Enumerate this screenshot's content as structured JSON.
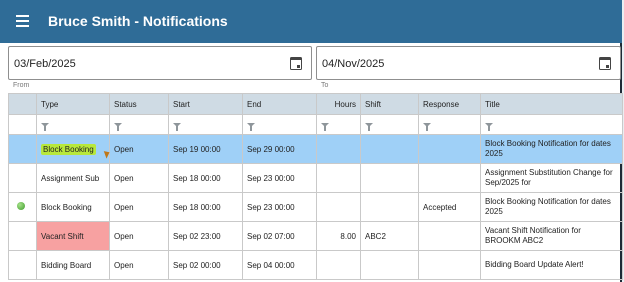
{
  "app": {
    "title": "Bruce Smith - Notifications"
  },
  "filters": {
    "from": {
      "value": "03/Feb/2025",
      "label": "From"
    },
    "to": {
      "value": "04/Nov/2025",
      "label": "To"
    }
  },
  "table": {
    "columns": [
      "Type",
      "Status",
      "Start",
      "End",
      "Hours",
      "Shift",
      "Response",
      "Title"
    ],
    "rows": [
      {
        "indicator": "",
        "type": "Block Booking",
        "status": "Open",
        "start": "Sep 19 00:00",
        "end": "Sep 29 00:00",
        "hours": "",
        "shift": "",
        "response": "",
        "title": "Block Booking Notification for dates 2025",
        "selected": true
      },
      {
        "indicator": "",
        "type": "Assignment Sub",
        "status": "Open",
        "start": "Sep 18 00:00",
        "end": "Sep 23 00:00",
        "hours": "",
        "shift": "",
        "response": "",
        "title": "Assignment Substitution Change for Sep/2025 for"
      },
      {
        "indicator": "green-status-dot-icon",
        "type": "Block Booking",
        "status": "Open",
        "start": "Sep 18 00:00",
        "end": "Sep 23 00:00",
        "hours": "",
        "shift": "",
        "response": "Accepted",
        "title": "Block Booking Notification for dates 2025"
      },
      {
        "indicator": "",
        "type": "Vacant Shift",
        "status": "Open",
        "start": "Sep 02 23:00",
        "end": "Sep 02 07:00",
        "hours": "8.00",
        "shift": "ABC2",
        "response": "",
        "title": "Vacant Shift Notification for BROOKM ABC2",
        "type_highlight": "#f7a1a1"
      },
      {
        "indicator": "",
        "type": "Bidding Board",
        "status": "Open",
        "start": "Sep 02 00:00",
        "end": "Sep 04 00:00",
        "hours": "",
        "shift": "",
        "response": "",
        "title": "Bidding Board Update Alert!"
      }
    ]
  },
  "colors": {
    "appbar": "#2f6c97",
    "header_row": "#cfdbe4",
    "selected_row": "#9fd0f7",
    "type_highlight": "#f7a1a1",
    "marker": "#b8e83b"
  }
}
